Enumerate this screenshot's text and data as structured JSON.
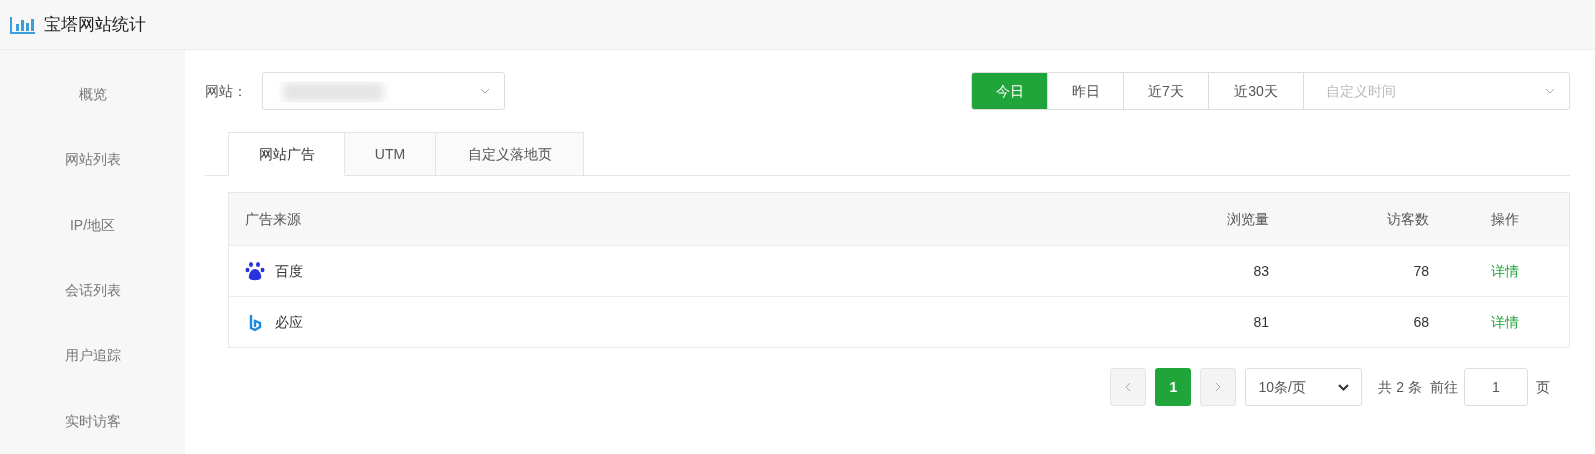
{
  "header": {
    "title": "宝塔网站统计"
  },
  "sidebar": {
    "items": [
      {
        "label": "概览",
        "selected": false
      },
      {
        "label": "网站列表",
        "selected": false
      },
      {
        "label": "IP/地区",
        "selected": false
      },
      {
        "label": "会话列表",
        "selected": false
      },
      {
        "label": "用户追踪",
        "selected": false
      },
      {
        "label": "实时访客",
        "selected": false
      }
    ]
  },
  "site_filter": {
    "label": "网站："
  },
  "date_range": {
    "buttons": [
      {
        "label": "今日",
        "selected": true
      },
      {
        "label": "昨日",
        "selected": false
      },
      {
        "label": "近7天",
        "selected": false
      },
      {
        "label": "近30天",
        "selected": false
      }
    ],
    "custom_placeholder": "自定义时间"
  },
  "tabs": [
    {
      "label": "网站广告",
      "selected": true
    },
    {
      "label": "UTM",
      "selected": false
    },
    {
      "label": "自定义落地页",
      "selected": false
    }
  ],
  "table": {
    "columns": [
      "广告来源",
      "浏览量",
      "访客数",
      "操作"
    ],
    "rows": [
      {
        "kind": "paw",
        "source": "百度",
        "views": "83",
        "visitors": "78",
        "action": "详情"
      },
      {
        "kind": "b",
        "source": "必应",
        "views": "81",
        "visitors": "68",
        "action": "详情"
      }
    ]
  },
  "pagination": {
    "pages": [
      {
        "label": "1",
        "selected": true
      }
    ],
    "page_size": "10条/页",
    "total": "共 2 条",
    "goto_label": "前往",
    "goto_value": "1",
    "page_suffix": "页"
  }
}
